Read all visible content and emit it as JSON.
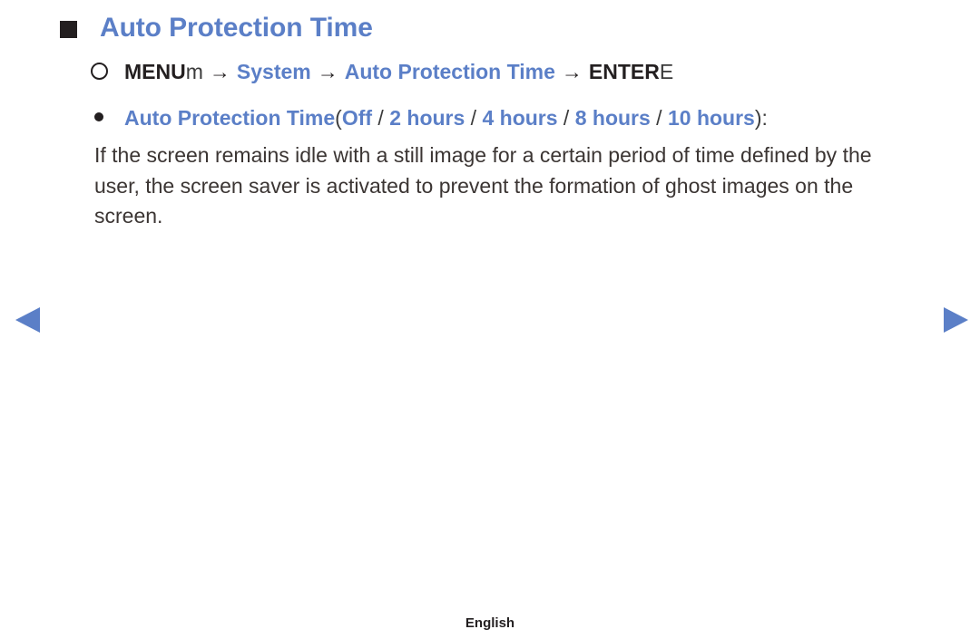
{
  "page": {
    "title": "Auto Protection Time",
    "background_color": "#ffffff",
    "accent_color": "#5b7fc7",
    "text_color": "#3b3533"
  },
  "title_row": {
    "bullet_icon": "filled-square-icon",
    "heading": "Auto Protection Time"
  },
  "menu_path": {
    "lead_icon": "circle-icon",
    "key_label": "MENU",
    "key_glyph": "m",
    "arrow": "→",
    "step_1": "System",
    "step_2": "Auto Protection Time",
    "enter_label": "ENTER",
    "enter_glyph": "E"
  },
  "option_line": {
    "bullet_icon": "filled-dot-icon",
    "setting_name": "Auto Protection Time",
    "open_paren": "(",
    "separator": " / ",
    "options": [
      "Off",
      "2 hours",
      "4 hours",
      "8 hours",
      "10 hours"
    ],
    "close_paren": ")",
    "colon": ":"
  },
  "body": {
    "paragraph": "If the screen remains idle with a still image for a certain period of time defined by the user, the screen saver is activated to prevent the formation of ghost images on the screen."
  },
  "navigation": {
    "previous_icon": "triangle-left-icon",
    "previous_label": "◀",
    "next_icon": "triangle-right-icon",
    "next_label": "▶"
  },
  "footer": {
    "language": "English"
  }
}
